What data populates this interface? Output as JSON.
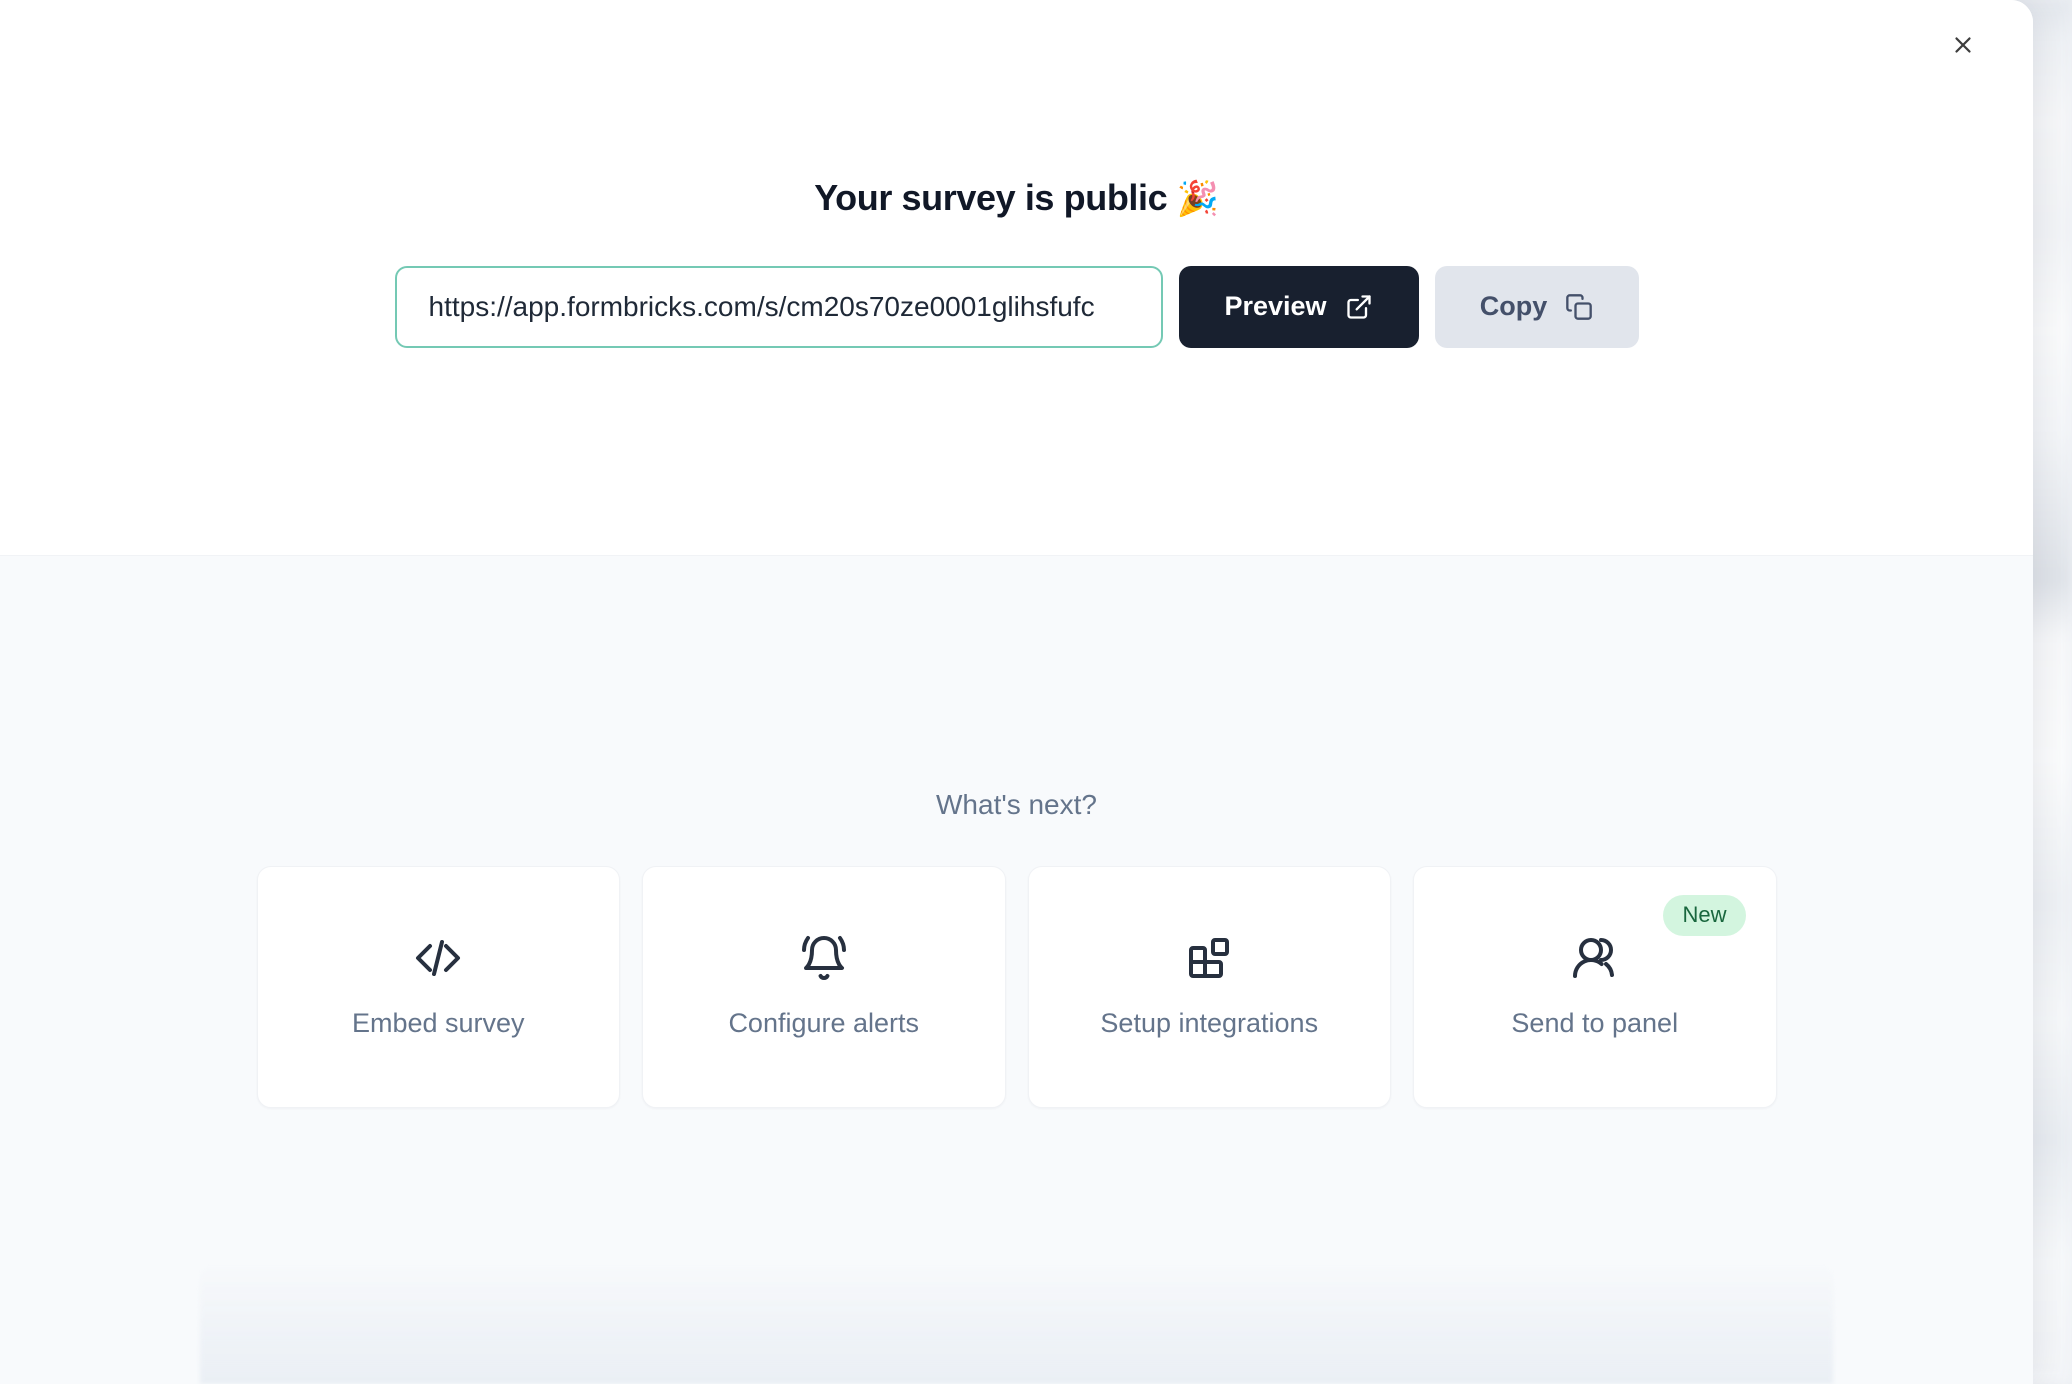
{
  "modal": {
    "close_label": "Close",
    "close_icon": "close-icon"
  },
  "header": {
    "title": "Your survey is public",
    "title_emoji": "🎉"
  },
  "share": {
    "url_value": "https://app.formbricks.com/s/cm20s70ze0001glihsfufc",
    "url_placeholder": "Survey link",
    "preview_label": "Preview",
    "preview_icon": "external-link-icon",
    "copy_label": "Copy",
    "copy_icon": "copy-icon",
    "input_border_color": "#74c9b4",
    "preview_bg_color": "#18202f",
    "copy_bg_color": "#e1e5ec"
  },
  "whats_next": {
    "heading": "What's next?",
    "cards": [
      {
        "label": "Embed survey",
        "icon": "code-icon",
        "badge": null
      },
      {
        "label": "Configure alerts",
        "icon": "bell-ring-icon",
        "badge": null
      },
      {
        "label": "Setup integrations",
        "icon": "blocks-icon",
        "badge": null
      },
      {
        "label": "Send to panel",
        "icon": "users-icon",
        "badge": "New"
      }
    ],
    "badge_bg_color": "#d3f5df",
    "badge_text_color": "#19673e"
  }
}
